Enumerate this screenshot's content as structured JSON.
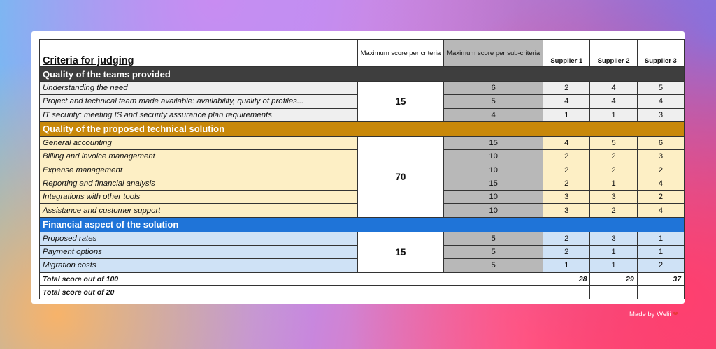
{
  "header": {
    "title": "Criteria for judging",
    "max_criteria": "Maximum score per criteria",
    "max_sub": "Maximum score per sub-criteria",
    "supplier1": "Supplier 1",
    "supplier2": "Supplier 2",
    "supplier3": "Supplier 3"
  },
  "sections": [
    {
      "title": "Quality of the teams provided",
      "max": "15",
      "rows": [
        {
          "label": "Understanding the need",
          "sub": "6",
          "s1": "2",
          "s2": "4",
          "s3": "5"
        },
        {
          "label": "Project and technical team made available: availability, quality of profiles...",
          "sub": "5",
          "s1": "4",
          "s2": "4",
          "s3": "4"
        },
        {
          "label": "IT security: meeting IS and security assurance plan requirements",
          "sub": "4",
          "s1": "1",
          "s2": "1",
          "s3": "3"
        }
      ]
    },
    {
      "title": "Quality of the proposed technical solution",
      "max": "70",
      "rows": [
        {
          "label": "General accounting",
          "sub": "15",
          "s1": "4",
          "s2": "5",
          "s3": "6"
        },
        {
          "label": "Billing and invoice management",
          "sub": "10",
          "s1": "2",
          "s2": "2",
          "s3": "3"
        },
        {
          "label": "Expense management",
          "sub": "10",
          "s1": "2",
          "s2": "2",
          "s3": "2"
        },
        {
          "label": "Reporting and financial analysis",
          "sub": "15",
          "s1": "2",
          "s2": "1",
          "s3": "4"
        },
        {
          "label": "Integrations with other tools",
          "sub": "10",
          "s1": "3",
          "s2": "3",
          "s3": "2"
        },
        {
          "label": "Assistance and customer support",
          "sub": "10",
          "s1": "3",
          "s2": "2",
          "s3": "4"
        }
      ]
    },
    {
      "title": "Financial aspect of the solution",
      "max": "15",
      "rows": [
        {
          "label": "Proposed rates",
          "sub": "5",
          "s1": "2",
          "s2": "3",
          "s3": "1"
        },
        {
          "label": "Payment options",
          "sub": "5",
          "s1": "2",
          "s2": "1",
          "s3": "1"
        },
        {
          "label": "Migration costs",
          "sub": "5",
          "s1": "1",
          "s2": "1",
          "s3": "2"
        }
      ]
    }
  ],
  "totals": {
    "t100_label": "Total score out of 100",
    "t100_s1": "28",
    "t100_s2": "29",
    "t100_s3": "37",
    "t20_label": "Total score out of 20"
  },
  "credit": "Made by Welii",
  "credit_icon": "heart-icon",
  "colors": {
    "section1": "#3e3e3e",
    "section2": "#c8880a",
    "section3": "#1f74d8",
    "sub_column": "#b8b8b8"
  }
}
